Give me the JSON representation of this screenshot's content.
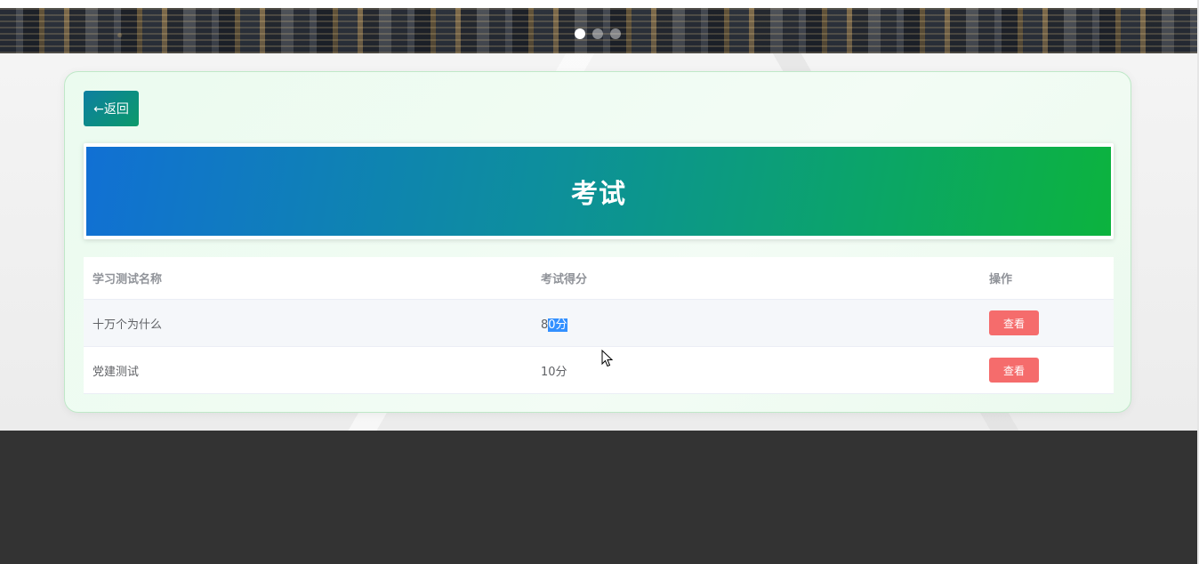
{
  "carousel": {
    "slides": 3,
    "active_index": 0
  },
  "actions": {
    "back_label": "←返回"
  },
  "page": {
    "title": "考试"
  },
  "table": {
    "headers": [
      "学习测试名称",
      "考试得分",
      "操作"
    ],
    "rows": [
      {
        "name": "十万个为什么",
        "score_prefix": "8",
        "score_selected": "0分",
        "action": "查看"
      },
      {
        "name": "党建测试",
        "score": "10分",
        "action": "查看"
      }
    ]
  },
  "colors": {
    "back_button": "#0c8f85",
    "hero_start": "#1170d4",
    "hero_end": "#0cb33e",
    "view_button": "#f56c6c",
    "footer": "#333333"
  }
}
